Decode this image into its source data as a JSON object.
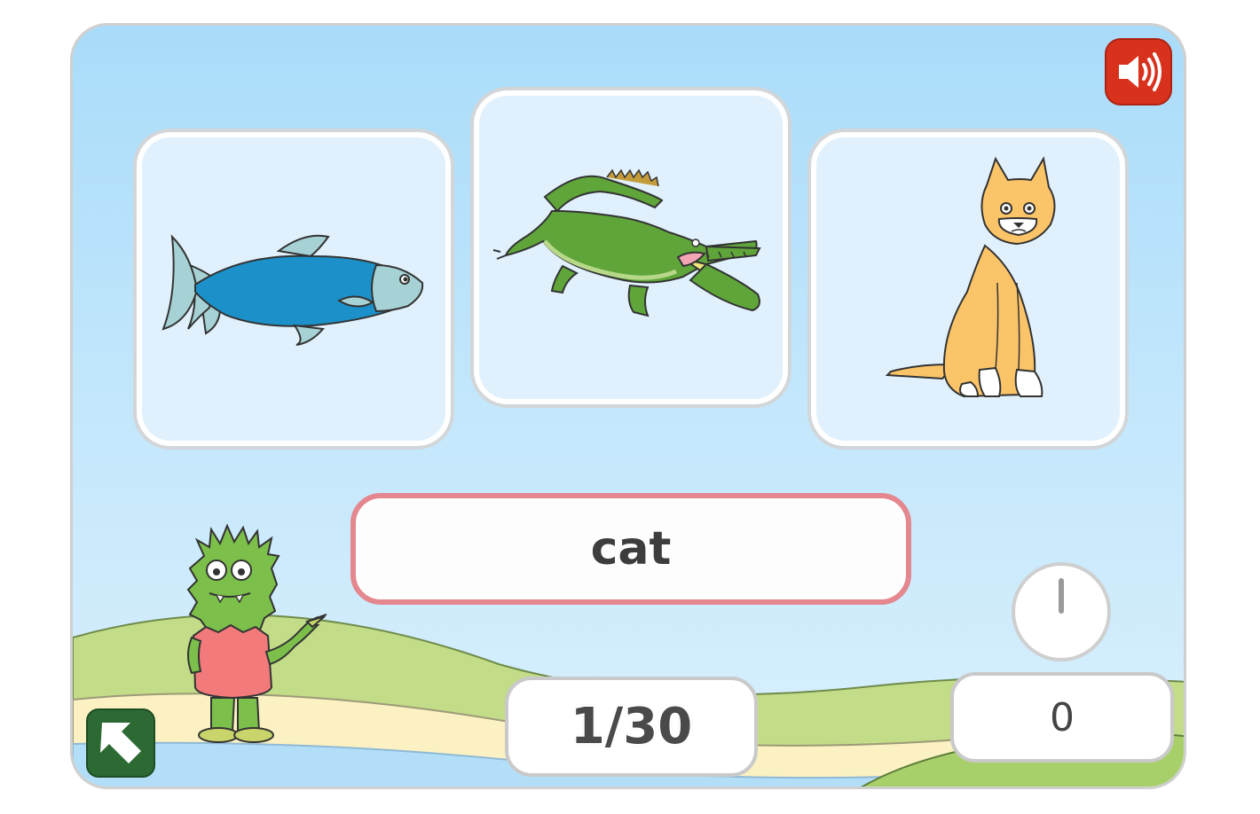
{
  "game": {
    "target_word": "cat",
    "progress": "1/30",
    "score": "0"
  },
  "cards": [
    {
      "animal": "fish"
    },
    {
      "animal": "crocodile"
    },
    {
      "animal": "cat"
    }
  ],
  "icons": {
    "sound": "speaker-icon",
    "back": "arrow-up-left-icon",
    "timer": "timer-icon"
  },
  "colors": {
    "sky_top": "#a9dcfa",
    "card_bg": "#e0f1fd",
    "sound_button": "#d8321d",
    "back_button": "#2d6a33",
    "word_border": "#e4878e",
    "grass": "#c2dc88",
    "sand": "#fbf1c2"
  }
}
